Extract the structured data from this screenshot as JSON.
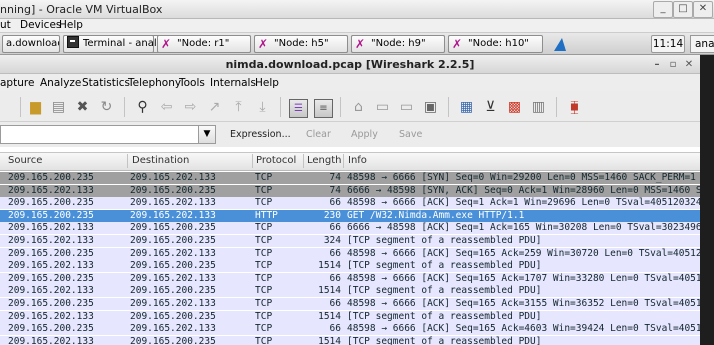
{
  "vbox": {
    "title": "nning] - Oracle VM VirtualBox",
    "menu": [
      "ut",
      "Devices",
      "Help"
    ]
  },
  "taskbar": {
    "items": [
      {
        "label": "a.download...."
      },
      {
        "label": "Terminal - analys..."
      },
      {
        "label": "\"Node: r1\""
      },
      {
        "label": "\"Node: h5\""
      },
      {
        "label": "\"Node: h9\""
      },
      {
        "label": "\"Node: h10\""
      }
    ],
    "clock": "11:14",
    "overflow_label": "analy"
  },
  "wireshark": {
    "title": "nimda.download.pcap [Wireshark 2.2.5]",
    "menu": [
      "apture",
      "Analyze",
      "Statistics",
      "Telephony",
      "Tools",
      "Internals",
      "Help"
    ],
    "filter": {
      "value": "",
      "expression_label": "Expression...",
      "clear_label": "Clear",
      "apply_label": "Apply",
      "save_label": "Save"
    },
    "columns": [
      "Source",
      "Destination",
      "Protocol",
      "Length",
      "Info"
    ],
    "colors": {
      "syn_row": "#a0a0a0",
      "selected_row": "#4a90d9",
      "tcp_row": "#e7e6ff",
      "http_row": "#e4ffc7"
    },
    "packets": [
      {
        "src": "209.165.200.235",
        "dst": "209.165.202.133",
        "proto": "TCP",
        "len": "74",
        "info": "48598 → 6666 [SYN] Seq=0 Win=29200 Len=0 MSS=1460 SACK_PERM=1 TSv",
        "kind": "syn"
      },
      {
        "src": "209.165.202.133",
        "dst": "209.165.200.235",
        "proto": "TCP",
        "len": "74",
        "info": "6666 → 48598 [SYN, ACK] Seq=0 Ack=1 Win=28960 Len=0 MSS=1460 SAC",
        "kind": "syn"
      },
      {
        "src": "209.165.200.235",
        "dst": "209.165.202.133",
        "proto": "TCP",
        "len": "66",
        "info": "48598 → 6666 [ACK] Seq=1 Ack=1 Win=29696 Len=0 TSval=4051203246",
        "kind": "tcp"
      },
      {
        "src": "209.165.200.235",
        "dst": "209.165.202.133",
        "proto": "HTTP",
        "len": "230",
        "info": "GET /W32.Nimda.Amm.exe HTTP/1.1",
        "kind": "selected"
      },
      {
        "src": "209.165.202.133",
        "dst": "209.165.200.235",
        "proto": "TCP",
        "len": "66",
        "info": "6666 → 48598 [ACK] Seq=1 Ack=165 Win=30208 Len=0 TSval=30234964",
        "kind": "tcp"
      },
      {
        "src": "209.165.202.133",
        "dst": "209.165.200.235",
        "proto": "TCP",
        "len": "324",
        "info": "[TCP segment of a reassembled PDU]",
        "kind": "tcp"
      },
      {
        "src": "209.165.200.235",
        "dst": "209.165.202.133",
        "proto": "TCP",
        "len": "66",
        "info": "48598 → 6666 [ACK] Seq=165 Ack=259 Win=30720 Len=0 TSval=4051203",
        "kind": "tcp"
      },
      {
        "src": "209.165.202.133",
        "dst": "209.165.200.235",
        "proto": "TCP",
        "len": "1514",
        "info": "[TCP segment of a reassembled PDU]",
        "kind": "tcp"
      },
      {
        "src": "209.165.200.235",
        "dst": "209.165.202.133",
        "proto": "TCP",
        "len": "66",
        "info": "48598 → 6666 [ACK] Seq=165 Ack=1707 Win=33280 Len=0 TSval=4051203",
        "kind": "tcp"
      },
      {
        "src": "209.165.202.133",
        "dst": "209.165.200.235",
        "proto": "TCP",
        "len": "1514",
        "info": "[TCP segment of a reassembled PDU]",
        "kind": "tcp"
      },
      {
        "src": "209.165.200.235",
        "dst": "209.165.202.133",
        "proto": "TCP",
        "len": "66",
        "info": "48598 → 6666 [ACK] Seq=165 Ack=3155 Win=36352 Len=0 TSval=4051203",
        "kind": "tcp"
      },
      {
        "src": "209.165.202.133",
        "dst": "209.165.200.235",
        "proto": "TCP",
        "len": "1514",
        "info": "[TCP segment of a reassembled PDU]",
        "kind": "tcp"
      },
      {
        "src": "209.165.200.235",
        "dst": "209.165.202.133",
        "proto": "TCP",
        "len": "66",
        "info": "48598 → 6666 [ACK] Seq=165 Ack=4603 Win=39424 Len=0 TSval=4051203",
        "kind": "tcp"
      },
      {
        "src": "209.165.202.133",
        "dst": "209.165.200.235",
        "proto": "TCP",
        "len": "1514",
        "info": "[TCP segment of a reassembled PDU]",
        "kind": "tcp"
      }
    ],
    "toolbar_icons": [
      "open-file-icon",
      "save-file-icon",
      "close-file-icon",
      "reload-icon",
      "find-icon",
      "go-back-icon",
      "go-forward-icon",
      "go-to-packet-icon",
      "go-first-icon",
      "go-last-icon",
      "colorize-icon",
      "auto-scroll-icon",
      "zoom-in-icon",
      "zoom-out-icon",
      "normal-size-icon",
      "resize-columns-icon",
      "capture-filters-icon",
      "display-filters-icon",
      "coloring-rules-icon",
      "preferences-icon",
      "help-icon"
    ]
  }
}
